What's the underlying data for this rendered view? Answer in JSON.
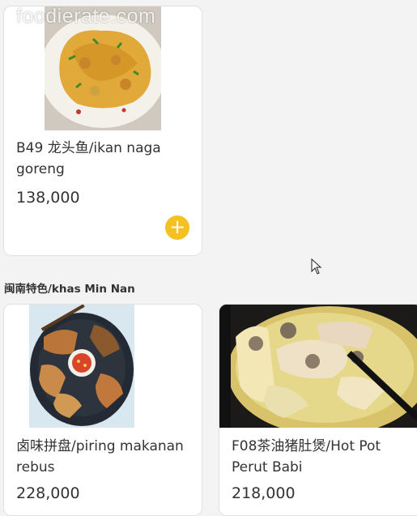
{
  "watermark": "foodierate.com",
  "sections": {
    "min_nan_title": "闽南特色/khas Min Nan"
  },
  "items": [
    {
      "name": "B49 龙头鱼/ikan naga goreng",
      "price": "138,000",
      "add_icon": "plus-icon"
    },
    {
      "name": "卤味拼盘/piring makanan rebus",
      "price": "228,000"
    },
    {
      "name": "F08茶油猪肚煲/Hot Pot Perut Babi",
      "price": "218,000"
    }
  ],
  "colors": {
    "add_button": "#f5c022",
    "page_background": "#f3f3f3"
  }
}
